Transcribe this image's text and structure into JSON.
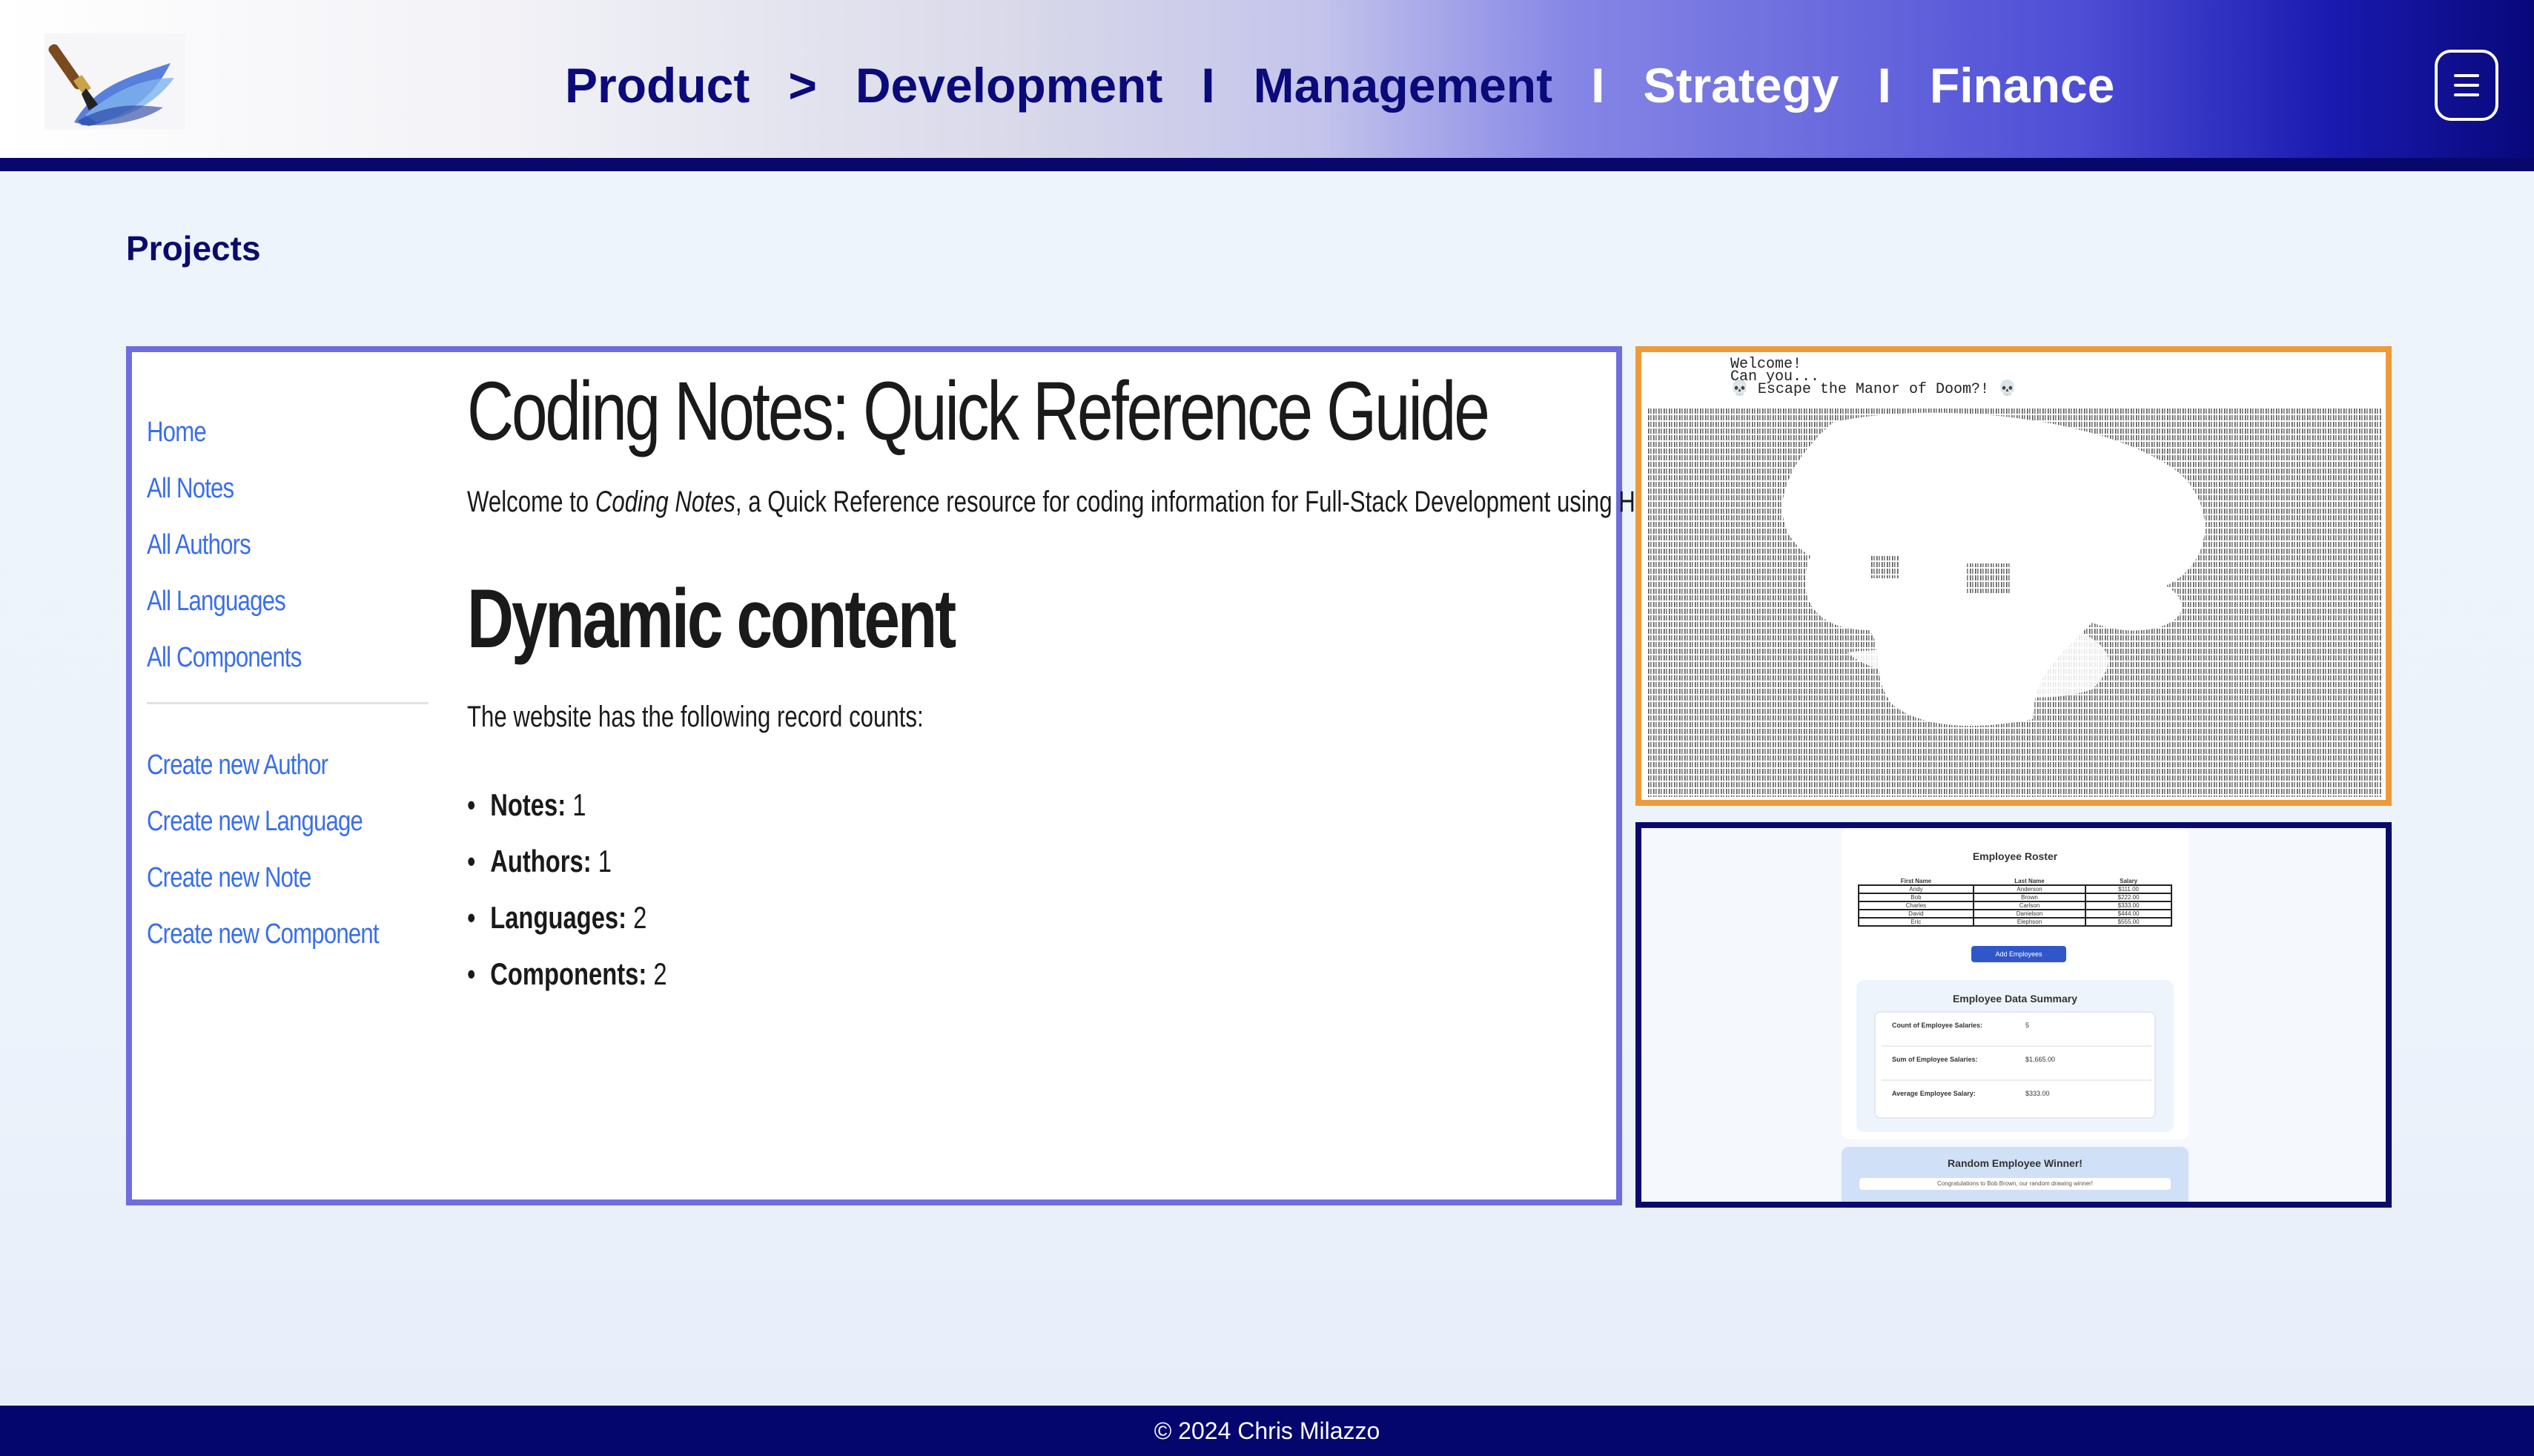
{
  "header": {
    "logo": "paintbrush-logo",
    "nav": [
      {
        "label": "Product"
      },
      {
        "sep": ">"
      },
      {
        "label": "Development"
      },
      {
        "sep": "I"
      },
      {
        "label": "Management"
      },
      {
        "sep": "I"
      },
      {
        "label": "Strategy"
      },
      {
        "sep": "I"
      },
      {
        "label": "Finance"
      }
    ],
    "menu_icon": "hamburger-icon"
  },
  "section": {
    "title": "Projects"
  },
  "coding_notes": {
    "sidebar": {
      "links_primary": [
        "Home",
        "All Notes",
        "All Authors",
        "All Languages",
        "All Components"
      ],
      "links_create": [
        "Create new Author",
        "Create new Language",
        "Create new Note",
        "Create new Component"
      ]
    },
    "title": "Coding Notes: Quick Reference Guide",
    "intro_before": "Welcome to ",
    "intro_em": "Coding Notes",
    "intro_after": ", a Quick Reference resource for coding information for Full-Stack Development using HTML, CSS, and JavaScript",
    "subtitle": "Dynamic content",
    "records_text": "The website has the following record counts:",
    "counts": [
      {
        "label": "Notes:",
        "value": "1"
      },
      {
        "label": "Authors:",
        "value": "1"
      },
      {
        "label": "Languages:",
        "value": "2"
      },
      {
        "label": "Components:",
        "value": "2"
      }
    ]
  },
  "manor_game": {
    "line1": "Welcome!",
    "line2": "Can you...",
    "line3": "💀 Escape the Manor of Doom?! 💀"
  },
  "employee_app": {
    "title": "Employee Roster",
    "columns": [
      "First Name",
      "Last Name",
      "Salary"
    ],
    "rows": [
      [
        "Andy",
        "Anderson",
        "$111.00"
      ],
      [
        "Bob",
        "Brown",
        "$222.00"
      ],
      [
        "Charles",
        "Carlson",
        "$333.00"
      ],
      [
        "David",
        "Danielson",
        "$444.00"
      ],
      [
        "Eric",
        "Elephson",
        "$555.00"
      ]
    ],
    "add_button": "Add Employees",
    "summary_title": "Employee Data Summary",
    "summary": [
      {
        "label": "Count of Employee Salaries:",
        "value": "5"
      },
      {
        "label": "Sum of Employee Salaries:",
        "value": "$1,665.00"
      },
      {
        "label": "Average Employee Salary:",
        "value": "$333.00"
      }
    ],
    "winner_title": "Random Employee Winner!",
    "winner_message": "Congratulations to Bob Brown, our random drawing winner!"
  },
  "footer": {
    "copyright": "© 2024 Chris Milazzo"
  },
  "colors": {
    "navy": "#0a0a6e",
    "card_main_border": "#6d6de0",
    "card_ascii_border": "#ef9a3a",
    "link_blue": "#3a6fe8"
  }
}
